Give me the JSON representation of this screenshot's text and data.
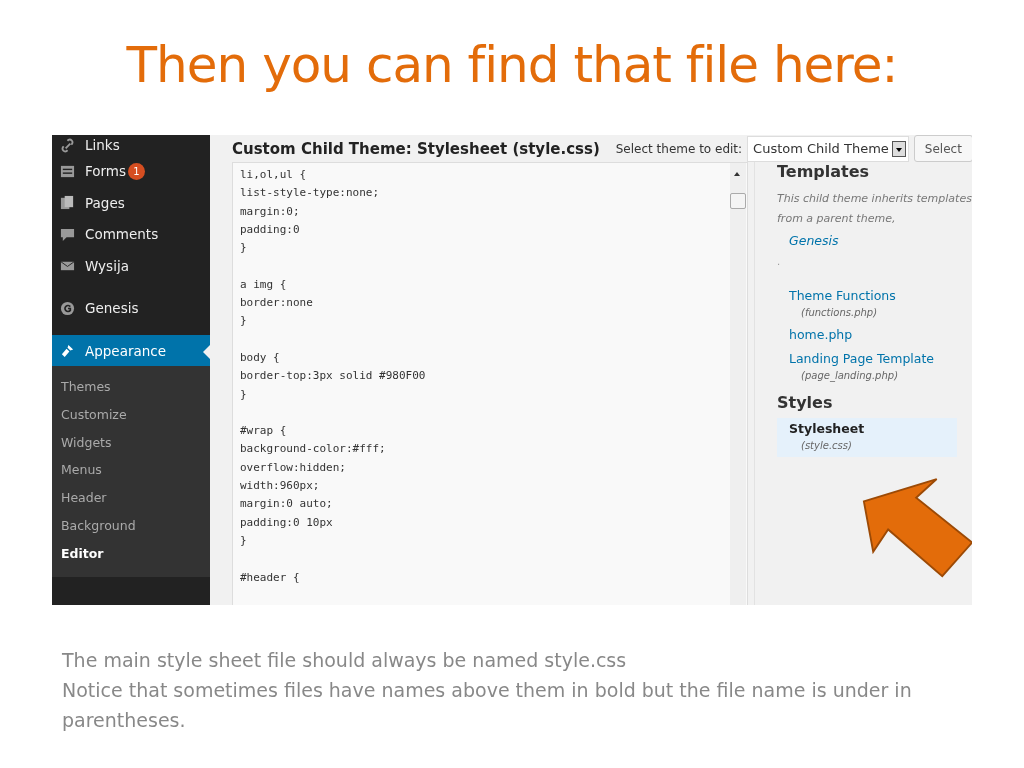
{
  "slide_title": "Then you can find that file here:",
  "sidebar": {
    "items": [
      {
        "label": "Links",
        "selected": false
      },
      {
        "label": "Forms",
        "badge": "1",
        "selected": false
      },
      {
        "label": "Pages",
        "selected": false
      },
      {
        "label": "Comments",
        "selected": false
      },
      {
        "label": "Wysija",
        "selected": false
      },
      {
        "label": "Genesis",
        "selected": false
      },
      {
        "label": "Appearance",
        "selected": true
      }
    ],
    "submenu": [
      {
        "label": "Themes",
        "selected": false
      },
      {
        "label": "Customize",
        "selected": false
      },
      {
        "label": "Widgets",
        "selected": false
      },
      {
        "label": "Menus",
        "selected": false
      },
      {
        "label": "Header",
        "selected": false
      },
      {
        "label": "Background",
        "selected": false
      },
      {
        "label": "Editor",
        "selected": true
      }
    ]
  },
  "editor": {
    "title": "Custom Child Theme: Stylesheet (style.css)",
    "select_label": "Select theme to edit:",
    "theme_value": "Custom Child Theme",
    "select_button": "Select",
    "code_blocks": [
      [
        "li,ol,ul {",
        "list-style-type:none;",
        "margin:0;",
        "padding:0",
        "}"
      ],
      [
        "a img {",
        "border:none",
        "}"
      ],
      [
        "body {",
        "border-top:3px solid #980F00",
        "}"
      ],
      [
        "#wrap {",
        "background-color:#fff;",
        "overflow:hidden;",
        "width:960px;",
        "margin:0 auto;",
        "padding:0 10px",
        "}"
      ],
      [
        "#header {"
      ]
    ]
  },
  "files": {
    "templates_heading": "Templates",
    "note": "This child theme inherits templates from a parent theme,",
    "parent_link": "Genesis",
    "dot": ".",
    "templates": [
      {
        "name": "Theme Functions",
        "file": "(functions.php)",
        "selected": false
      },
      {
        "name": "home.php",
        "selected": false
      },
      {
        "name": "Landing Page Template",
        "file": "(page_landing.php)",
        "selected": false
      }
    ],
    "styles_heading": "Styles",
    "styles": [
      {
        "name": "Stylesheet",
        "file": "(style.css)",
        "selected": true
      }
    ]
  },
  "caption": [
    "The main style sheet file should always be named style.css",
    "Notice that sometimes files have names above them in bold but the file name is under in parentheses."
  ]
}
